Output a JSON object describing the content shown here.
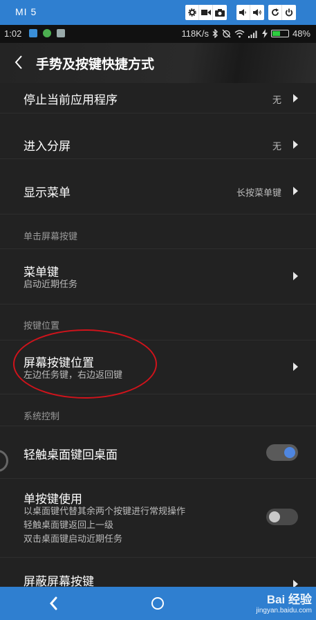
{
  "frame": {
    "device_name": "MI 5",
    "tools_left": [
      "gear-icon",
      "video-icon",
      "camera-icon"
    ],
    "tools_mid": [
      "volume-down-icon",
      "volume-up-icon"
    ],
    "tools_right": [
      "rotate-icon",
      "power-icon"
    ]
  },
  "status_bar": {
    "time": "1:02",
    "speed": "118K/s",
    "battery": "48%",
    "battery_level": 0.48
  },
  "header": {
    "title": "手势及按键快捷方式"
  },
  "items": {
    "stop_app": {
      "title": "停止当前应用程序",
      "value": "无"
    },
    "split_screen": {
      "title": "进入分屏",
      "value": "无"
    },
    "show_menu": {
      "title": "显示菜单",
      "value": "长按菜单键"
    },
    "section_single_tap": "单击屏幕按键",
    "menu_key": {
      "title": "菜单键",
      "subtitle": "启动近期任务"
    },
    "section_key_position": "按键位置",
    "key_position": {
      "title": "屏幕按键位置",
      "subtitle": "左边任务键，右边返回键"
    },
    "section_system": "系统控制",
    "touch_home": {
      "title": "轻触桌面键回桌面",
      "on": true
    },
    "single_key": {
      "title": "单按键使用",
      "subtitle_lines": [
        "以桌面键代替其余两个按键进行常规操作",
        "轻触桌面键返回上一级",
        "双击桌面键启动近期任务"
      ],
      "on": false
    },
    "hide_keys": {
      "title": "屏蔽屏幕按键"
    }
  },
  "colors": {
    "accent": "#2f7fd0",
    "toggle_on_track": "#5a5a5a",
    "toggle_on_knob": "#4f86e0",
    "toggle_off_track": "#4a4a4a",
    "toggle_off_knob": "#c8c8c8",
    "annotation": "#d0131b"
  },
  "watermark": {
    "brand": "Bai 经验",
    "url": "jingyan.baidu.com"
  }
}
